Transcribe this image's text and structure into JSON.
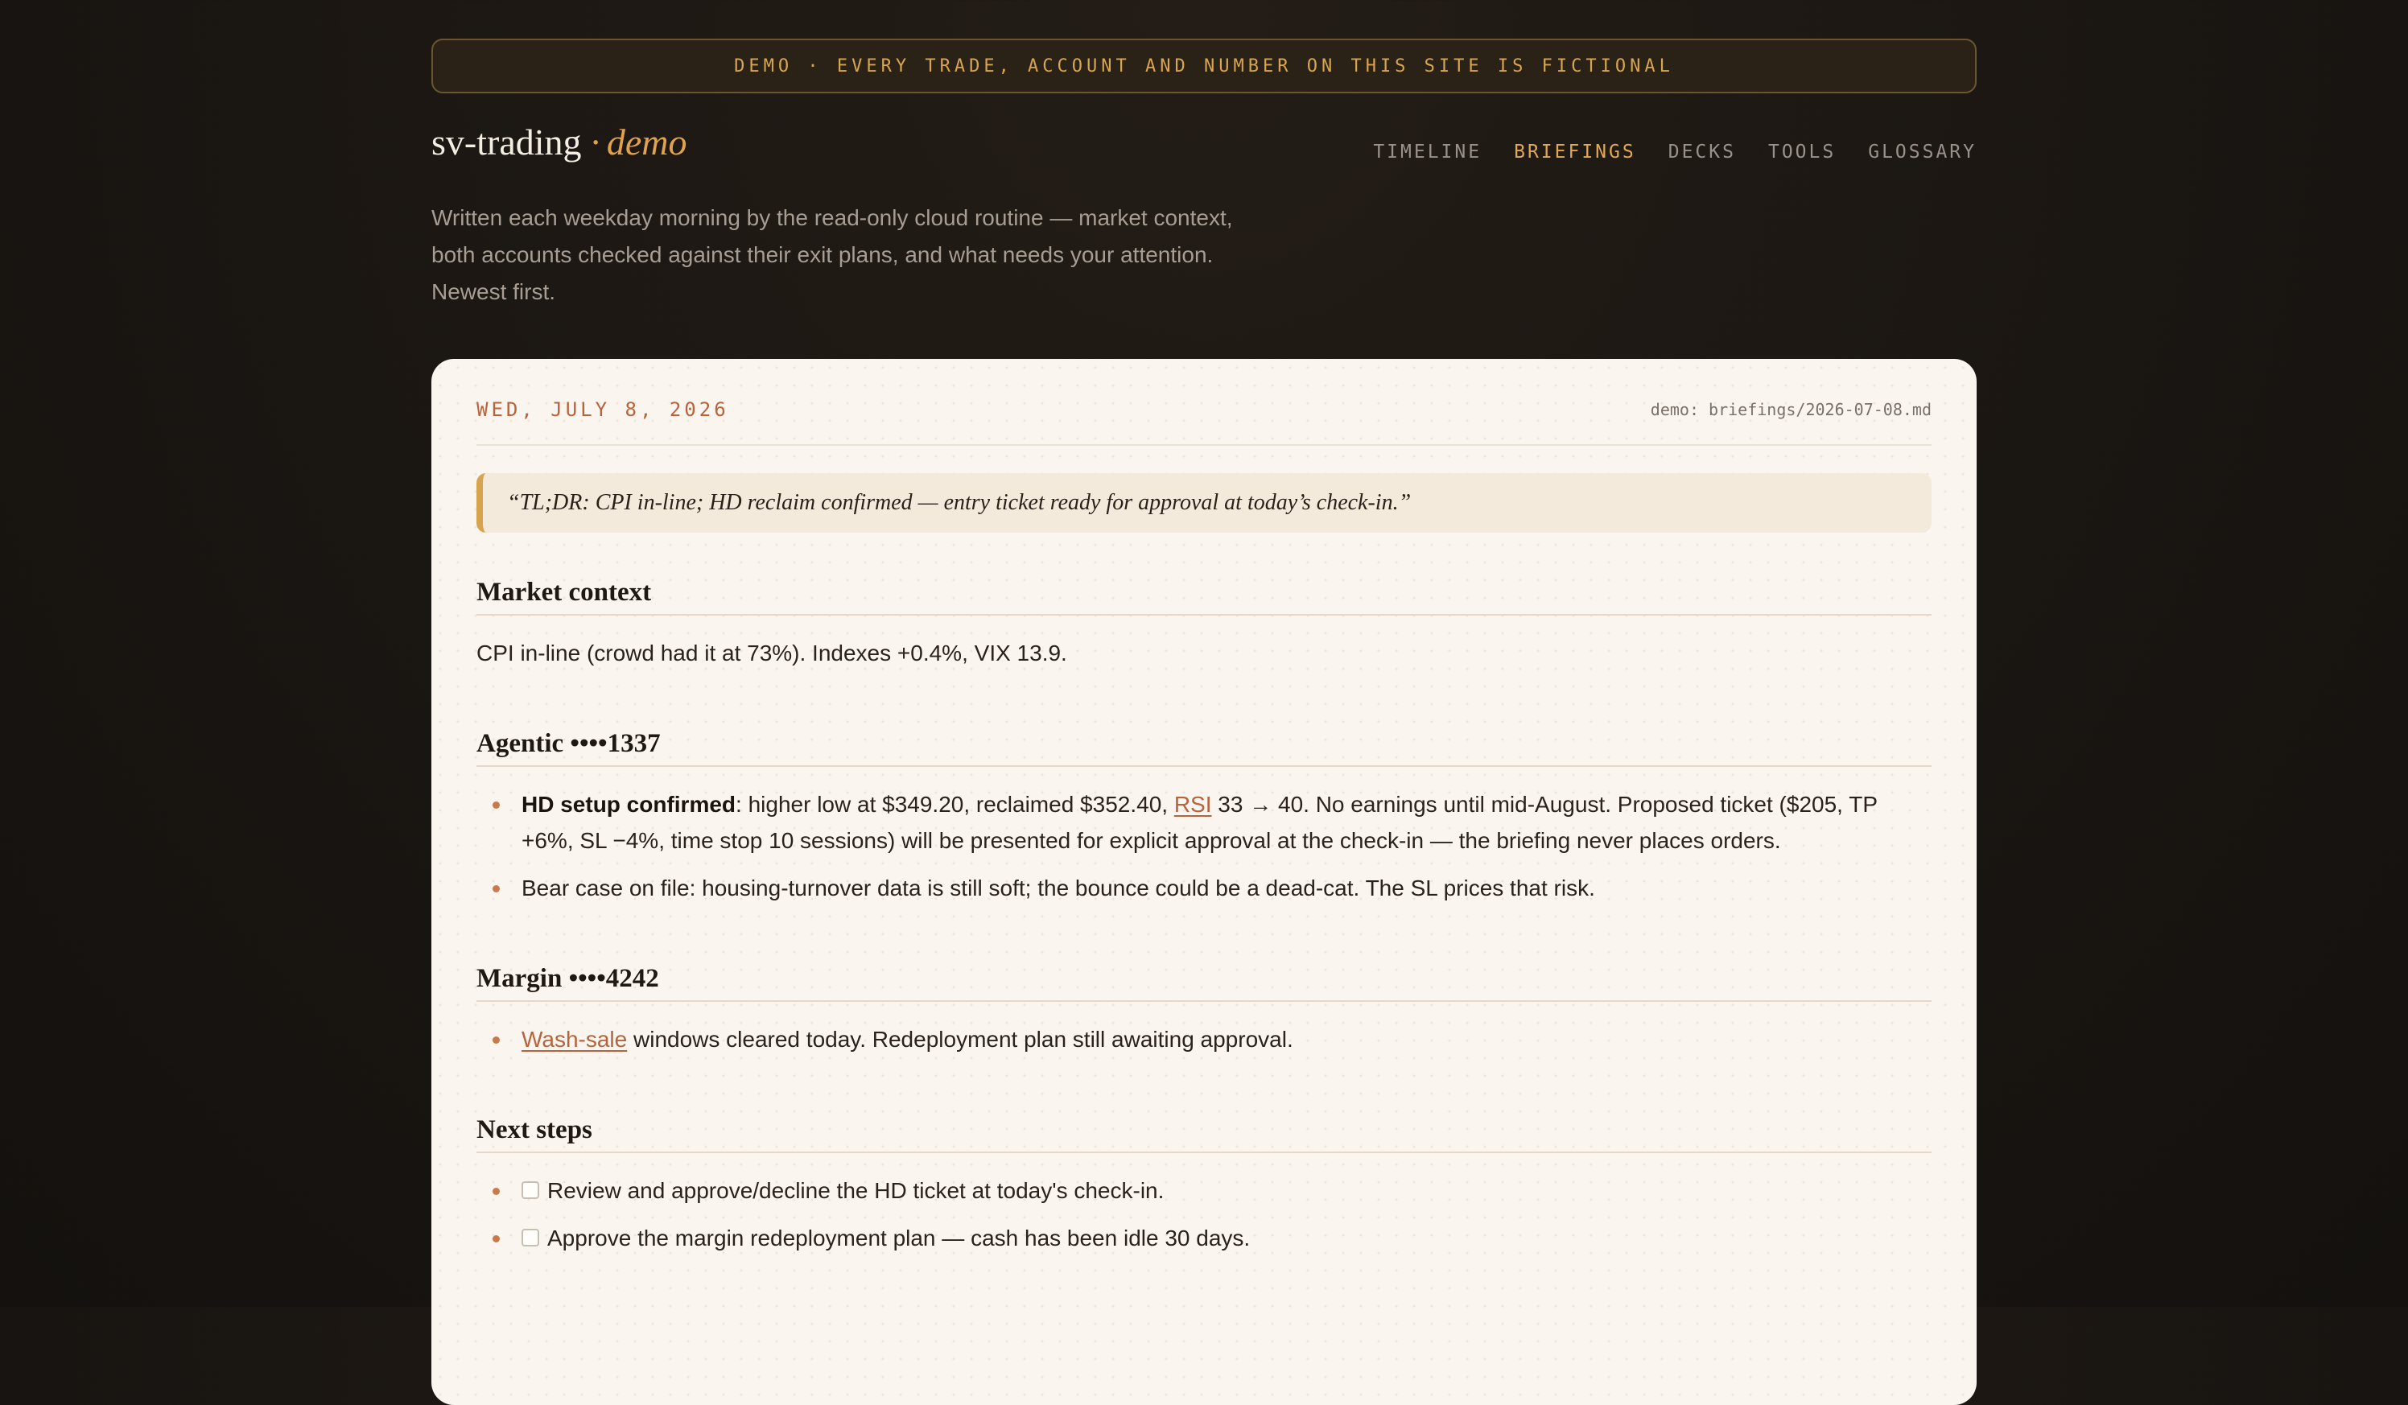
{
  "banner": {
    "text": "DEMO · EVERY TRADE, ACCOUNT AND NUMBER ON THIS SITE IS FICTIONAL"
  },
  "brand": {
    "name": "sv-trading",
    "separator": "·",
    "suffix": "demo"
  },
  "nav": {
    "items": [
      {
        "label": "TIMELINE",
        "active": false
      },
      {
        "label": "BRIEFINGS",
        "active": true
      },
      {
        "label": "DECKS",
        "active": false
      },
      {
        "label": "TOOLS",
        "active": false
      },
      {
        "label": "GLOSSARY",
        "active": false
      }
    ]
  },
  "intro": {
    "line1": "Written each weekday morning by the read-only cloud routine — market context,",
    "line2": "both accounts checked against their exit plans, and what needs your attention.",
    "line3": "Newest first."
  },
  "briefing": {
    "date": "WED, JULY 8, 2026",
    "source": "demo: briefings/2026-07-08.md",
    "tldr": "“TL;DR: CPI in-line; HD reclaim confirmed — entry ticket ready for approval at today’s check-in.”",
    "market": {
      "heading": "Market context",
      "text": "CPI in-line (crowd had it at 73%). Indexes +0.4%, VIX 13.9."
    },
    "agentic": {
      "heading": "Agentic ••••1337",
      "b1_bold": "HD setup confirmed",
      "b1_pre": ": higher low at $349.20, reclaimed $352.40, ",
      "b1_link": "RSI",
      "b1_post": " 33 → 40. No earnings until mid-August. Proposed ticket ($205, TP +6%, SL −4%, time stop 10 sessions) will be presented for explicit approval at the check-in — the briefing never places orders.",
      "b2": "Bear case on file: housing-turnover data is still soft; the bounce could be a dead-cat. The SL prices that risk."
    },
    "margin": {
      "heading": "Margin ••••4242",
      "b1_link": "Wash-sale",
      "b1_post": " windows cleared today. Redeployment plan still awaiting approval."
    },
    "next": {
      "heading": "Next steps",
      "t1": "Review and approve/decline the HD ticket at today's check-in.",
      "t2": "Approve the margin redeployment plan — cash has been idle 30 days."
    }
  }
}
